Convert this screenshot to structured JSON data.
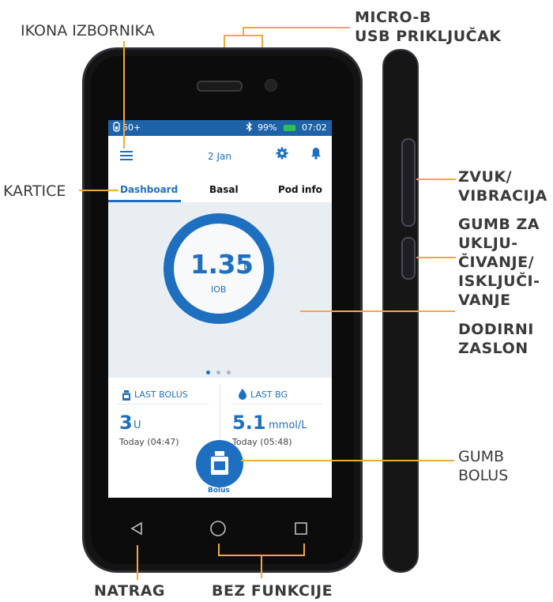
{
  "callouts": {
    "menu_icon": "IKONA IZBORNIKA",
    "usb_line1": "MICRO-B",
    "usb_line2": "USB PRIKLJUČAK",
    "tabs": "KARTICE",
    "sound_line1": "ZVUK/",
    "sound_line2": "VIBRACIJA",
    "power_line1": "GUMB ZA",
    "power_line2": "UKLJU-",
    "power_line3": "ČIVANJE/",
    "power_line4": "ISKLJUČI-",
    "power_line5": "VANJE",
    "touch_line1": "DODIRNI",
    "touch_line2": "ZASLON",
    "bolus_line1": "GUMB",
    "bolus_line2": "BOLUS",
    "back": "NATRAG",
    "nofunc": "BEZ FUNKCIJE"
  },
  "screen": {
    "status": {
      "pod_reservoir": "50+",
      "bluetooth_icon": "bluetooth-icon",
      "battery": "99%",
      "time": "07:02"
    },
    "header": {
      "menu_icon": "hamburger-icon",
      "date": "2 Jan",
      "settings_icon": "gear-icon",
      "notifications_icon": "bell-icon"
    },
    "tabs": [
      "Dashboard",
      "Basal",
      "Pod info"
    ],
    "iob": {
      "value": "1.35",
      "unit": "U",
      "label": "IOB"
    },
    "last_bolus": {
      "label": "LAST BOLUS",
      "value": "3",
      "unit": "U",
      "time": "Today (04:47)"
    },
    "last_bg": {
      "label": "LAST BG",
      "value": "5.1",
      "unit": "mmol/L",
      "time": "Today (05:48)"
    },
    "bolus_button": "Bolus"
  },
  "colors": {
    "accent": "#1e6fc0",
    "status_bar": "#1e63a8",
    "callout_line": "#f2a93b",
    "battery": "#2fbf4a"
  }
}
